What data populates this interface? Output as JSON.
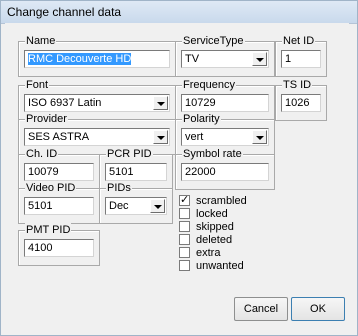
{
  "window": {
    "title": "Change channel data"
  },
  "fields": {
    "name": {
      "label": "Name",
      "value": "RMC Decouverte HD"
    },
    "service_type": {
      "label": "ServiceType",
      "value": "TV"
    },
    "net_id": {
      "label": "Net ID",
      "value": "1"
    },
    "font": {
      "label": "Font",
      "value": "ISO 6937 Latin"
    },
    "frequency": {
      "label": "Frequency",
      "value": "10729"
    },
    "ts_id": {
      "label": "TS ID",
      "value": "1026"
    },
    "provider": {
      "label": "Provider",
      "value": "SES ASTRA"
    },
    "polarity": {
      "label": "Polarity",
      "value": "vert"
    },
    "ch_id": {
      "label": "Ch. ID",
      "value": "10079"
    },
    "pcr_pid": {
      "label": "PCR PID",
      "value": "5101"
    },
    "symbol_rate": {
      "label": "Symbol rate",
      "value": "22000"
    },
    "video_pid": {
      "label": "Video PID",
      "value": "5101"
    },
    "pids": {
      "label": "PIDs",
      "value": "Dec"
    },
    "pmt_pid": {
      "label": "PMT PID",
      "value": "4100"
    }
  },
  "checkboxes": [
    {
      "label": "scrambled",
      "checked": true
    },
    {
      "label": "locked",
      "checked": false
    },
    {
      "label": "skipped",
      "checked": false
    },
    {
      "label": "deleted",
      "checked": false
    },
    {
      "label": "extra",
      "checked": false
    },
    {
      "label": "unwanted",
      "checked": false
    }
  ],
  "buttons": {
    "cancel": "Cancel",
    "ok": "OK"
  }
}
